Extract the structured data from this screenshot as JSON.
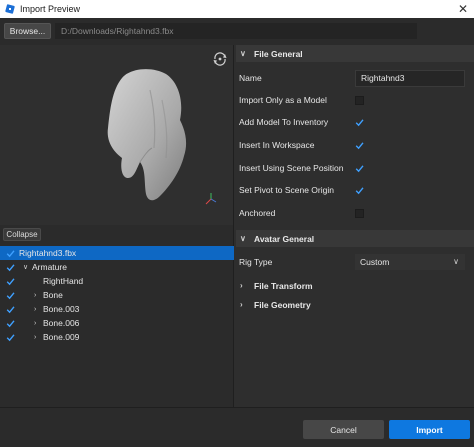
{
  "window": {
    "title": "Import Preview",
    "close_glyph": "✕"
  },
  "pathbar": {
    "browse_label": "Browse...",
    "path": "D:/Downloads/Rightahnd3.fbx"
  },
  "tree": {
    "collapse_label": "Collapse",
    "items": [
      {
        "label": "Rightahnd3.fbx",
        "checked": true,
        "selected": true,
        "arrow": ""
      },
      {
        "label": "Armature",
        "checked": true,
        "selected": false,
        "arrow": "∨"
      },
      {
        "label": "RightHand",
        "checked": true,
        "selected": false,
        "arrow": ""
      },
      {
        "label": "Bone",
        "checked": true,
        "selected": false,
        "arrow": "›"
      },
      {
        "label": "Bone.003",
        "checked": true,
        "selected": false,
        "arrow": "›"
      },
      {
        "label": "Bone.006",
        "checked": true,
        "selected": false,
        "arrow": "›"
      },
      {
        "label": "Bone.009",
        "checked": true,
        "selected": false,
        "arrow": "›"
      }
    ]
  },
  "file_general": {
    "title": "File General",
    "name_label": "Name",
    "name_value": "Rightahnd3",
    "options": [
      {
        "label": "Import Only as a Model",
        "checked": false
      },
      {
        "label": "Add Model To Inventory",
        "checked": true
      },
      {
        "label": "Insert In Workspace",
        "checked": true
      },
      {
        "label": "Insert Using Scene Position",
        "checked": true
      },
      {
        "label": "Set Pivot to Scene Origin",
        "checked": true
      },
      {
        "label": "Anchored",
        "checked": false
      }
    ]
  },
  "avatar_general": {
    "title": "Avatar General",
    "rig_type_label": "Rig Type",
    "rig_type_value": "Custom"
  },
  "file_transform": {
    "title": "File Transform"
  },
  "file_geometry": {
    "title": "File Geometry"
  },
  "footer": {
    "cancel_label": "Cancel",
    "import_label": "Import"
  },
  "colors": {
    "accent": "#0e78e0",
    "selection": "#0e68c4",
    "check": "#3fa0ff"
  }
}
